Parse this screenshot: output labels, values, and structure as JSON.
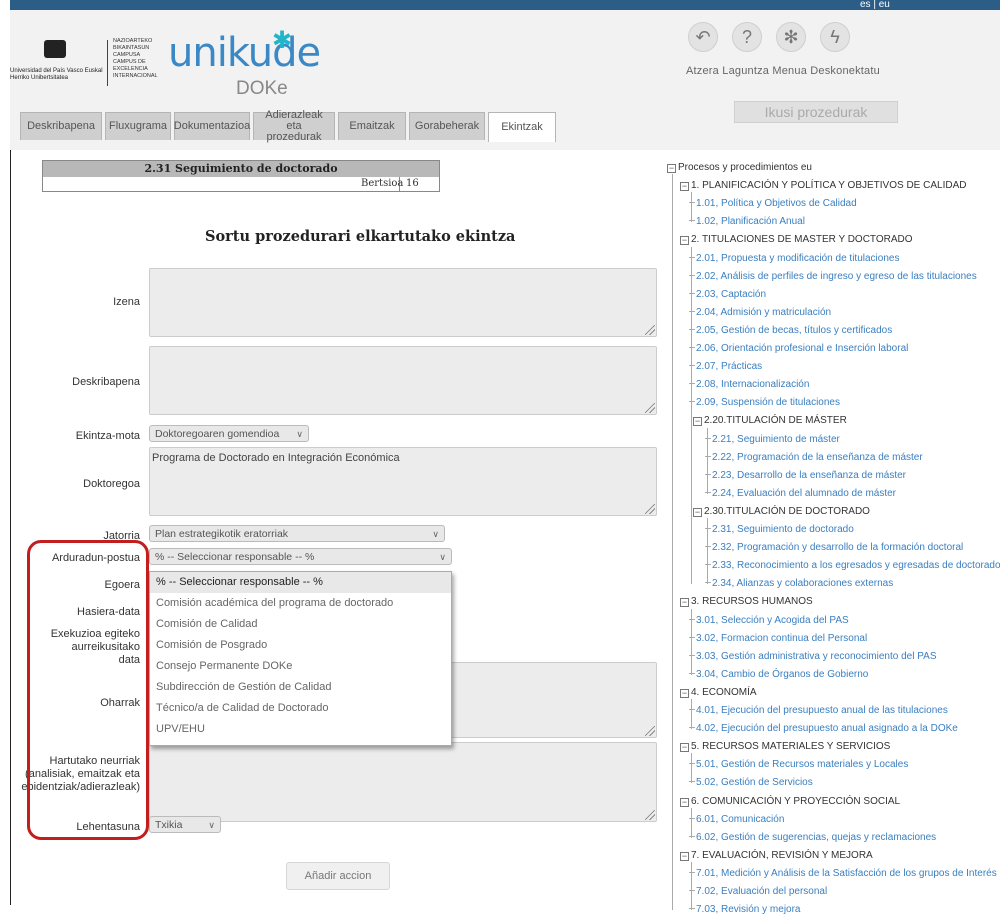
{
  "header": {
    "lang": "es | eu",
    "university": "Universidad del País Vasco  Euskal Herriko Unibertsitatea",
    "campus": "NAZIOARTEKO BIKAINTASUN CAMPUSA  CAMPUS DE EXCELENCIA INTERNACIONAL",
    "brand": "unikude",
    "brand_sub": "DOKe",
    "tools": [
      {
        "icon": "undo-icon",
        "glyph": "↶",
        "label": "Atzera"
      },
      {
        "icon": "help-icon",
        "glyph": "?",
        "label": "Laguntza"
      },
      {
        "icon": "menu-icon",
        "glyph": "✻",
        "label": "Menua"
      },
      {
        "icon": "disconnect-icon",
        "glyph": "ϟ",
        "label": "Deskonektatu"
      }
    ],
    "ikusi_label": "Ikusi prozedurak"
  },
  "tabs": [
    {
      "label": "Deskribapena"
    },
    {
      "label": "Fluxugrama"
    },
    {
      "label": "Dokumentazioa"
    },
    {
      "label": "Adierazleak eta prozedurak"
    },
    {
      "label": "Emaitzak"
    },
    {
      "label": "Gorabeherak"
    },
    {
      "label": "Ekintzak"
    }
  ],
  "doc": {
    "title": "2.31 Seguimiento de doctorado",
    "version_label": "Bertsioa",
    "version": "16"
  },
  "form": {
    "title": "Sortu prozedurari elkartutako ekintza",
    "labels": {
      "izena": "Izena",
      "deskribapena": "Deskribapena",
      "ekintza_mota": "Ekintza-mota",
      "doktoregoa": "Doktoregoa",
      "jatorria": "Jatorria",
      "arduradun": "Arduradun-postua",
      "egoera": "Egoera",
      "hasiera": "Hasiera-data",
      "exekuzioa": "Exekuzioa egiteko aurreikusitako data",
      "oharrak": "Oharrak",
      "hartutako": "Hartutako neurriak (analisiak, emaitzak eta ebidentziak/adierazleak)",
      "lehentasuna": "Lehentasuna"
    },
    "ekintza_mota_value": "Doktoregoaren gomendioa",
    "doktoregoa_value": "Programa de Doctorado en Integración Económica",
    "jatorria_value": "Plan estrategikotik eratorriak",
    "arduradun_value": "% -- Seleccionar responsable -- %",
    "lehentasuna_value": "Txikia",
    "arduradun_options": [
      "% -- Seleccionar responsable -- %",
      "Comisión académica del programa de doctorado",
      "Comisión de Calidad",
      "Comisión de Posgrado",
      "Consejo Permanente DOKe",
      "Subdirección de Gestión de Calidad",
      "Técnico/a de Calidad de Doctorado",
      "UPV/EHU"
    ],
    "submit_label": "Añadir accion"
  },
  "tree": {
    "root": "Procesos y procedimientos eu",
    "groups": [
      {
        "label": "1. PLANIFICACIÓN Y POLÍTICA Y OBJETIVOS DE CALIDAD",
        "items": [
          "1.01, Política y Objetivos de Calidad",
          "1.02, Planificación Anual"
        ]
      },
      {
        "label": "2. TITULACIONES DE MASTER Y DOCTORADO",
        "items": [
          "2.01, Propuesta y modificación de titulaciones",
          "2.02, Análisis de perfiles de ingreso y egreso de las titulaciones",
          "2.03, Captación",
          "2.04, Admisión y matriculación",
          "2.05, Gestión de becas, títulos y certificados",
          "2.06, Orientación profesional e Inserción laboral",
          "2.07, Prácticas",
          "2.08, Internacionalización",
          "2.09, Suspensión de titulaciones"
        ],
        "subgroups": [
          {
            "label": "2.20.TITULACIÓN DE MÁSTER",
            "items": [
              "2.21, Seguimiento de máster",
              "2.22, Programación de la enseñanza de máster",
              "2.23, Desarrollo de la enseñanza de máster",
              "2.24, Evaluación del alumnado de máster"
            ]
          },
          {
            "label": "2.30.TITULACIÓN DE DOCTORADO",
            "items": [
              "2.31, Seguimiento de doctorado",
              "2.32, Programación y desarrollo de la formación doctoral",
              "2.33, Reconocimiento a los egresados y egresadas de doctorado",
              "2.34, Alianzas y colaboraciones externas"
            ]
          }
        ]
      },
      {
        "label": "3. RECURSOS HUMANOS",
        "items": [
          "3.01, Selección y Acogida del PAS",
          "3.02, Formacion continua del Personal",
          "3.03, Gestión administrativa y reconocimiento del PAS",
          "3.04, Cambio de Órganos de Gobierno"
        ]
      },
      {
        "label": "4. ECONOMÍA",
        "items": [
          "4.01, Ejecución del presupuesto anual de las titulaciones",
          "4.02, Ejecución del presupuesto anual asignado a la DOKe"
        ]
      },
      {
        "label": "5. RECURSOS MATERIALES Y SERVICIOS",
        "items": [
          "5.01, Gestión de Recursos materiales y Locales",
          "5.02, Gestión de Servicios"
        ]
      },
      {
        "label": "6. COMUNICACIÓN Y PROYECCIÓN SOCIAL",
        "items": [
          "6.01, Comunicación",
          "6.02, Gestión de sugerencias, quejas y reclamaciones"
        ]
      },
      {
        "label": "7. EVALUACIÓN, REVISIÓN Y MEJORA",
        "items": [
          "7.01, Medición y Análisis de la Satisfacción de los grupos de Interés",
          "7.02, Evaluación del personal",
          "7.03, Revisión y mejora"
        ]
      }
    ]
  }
}
